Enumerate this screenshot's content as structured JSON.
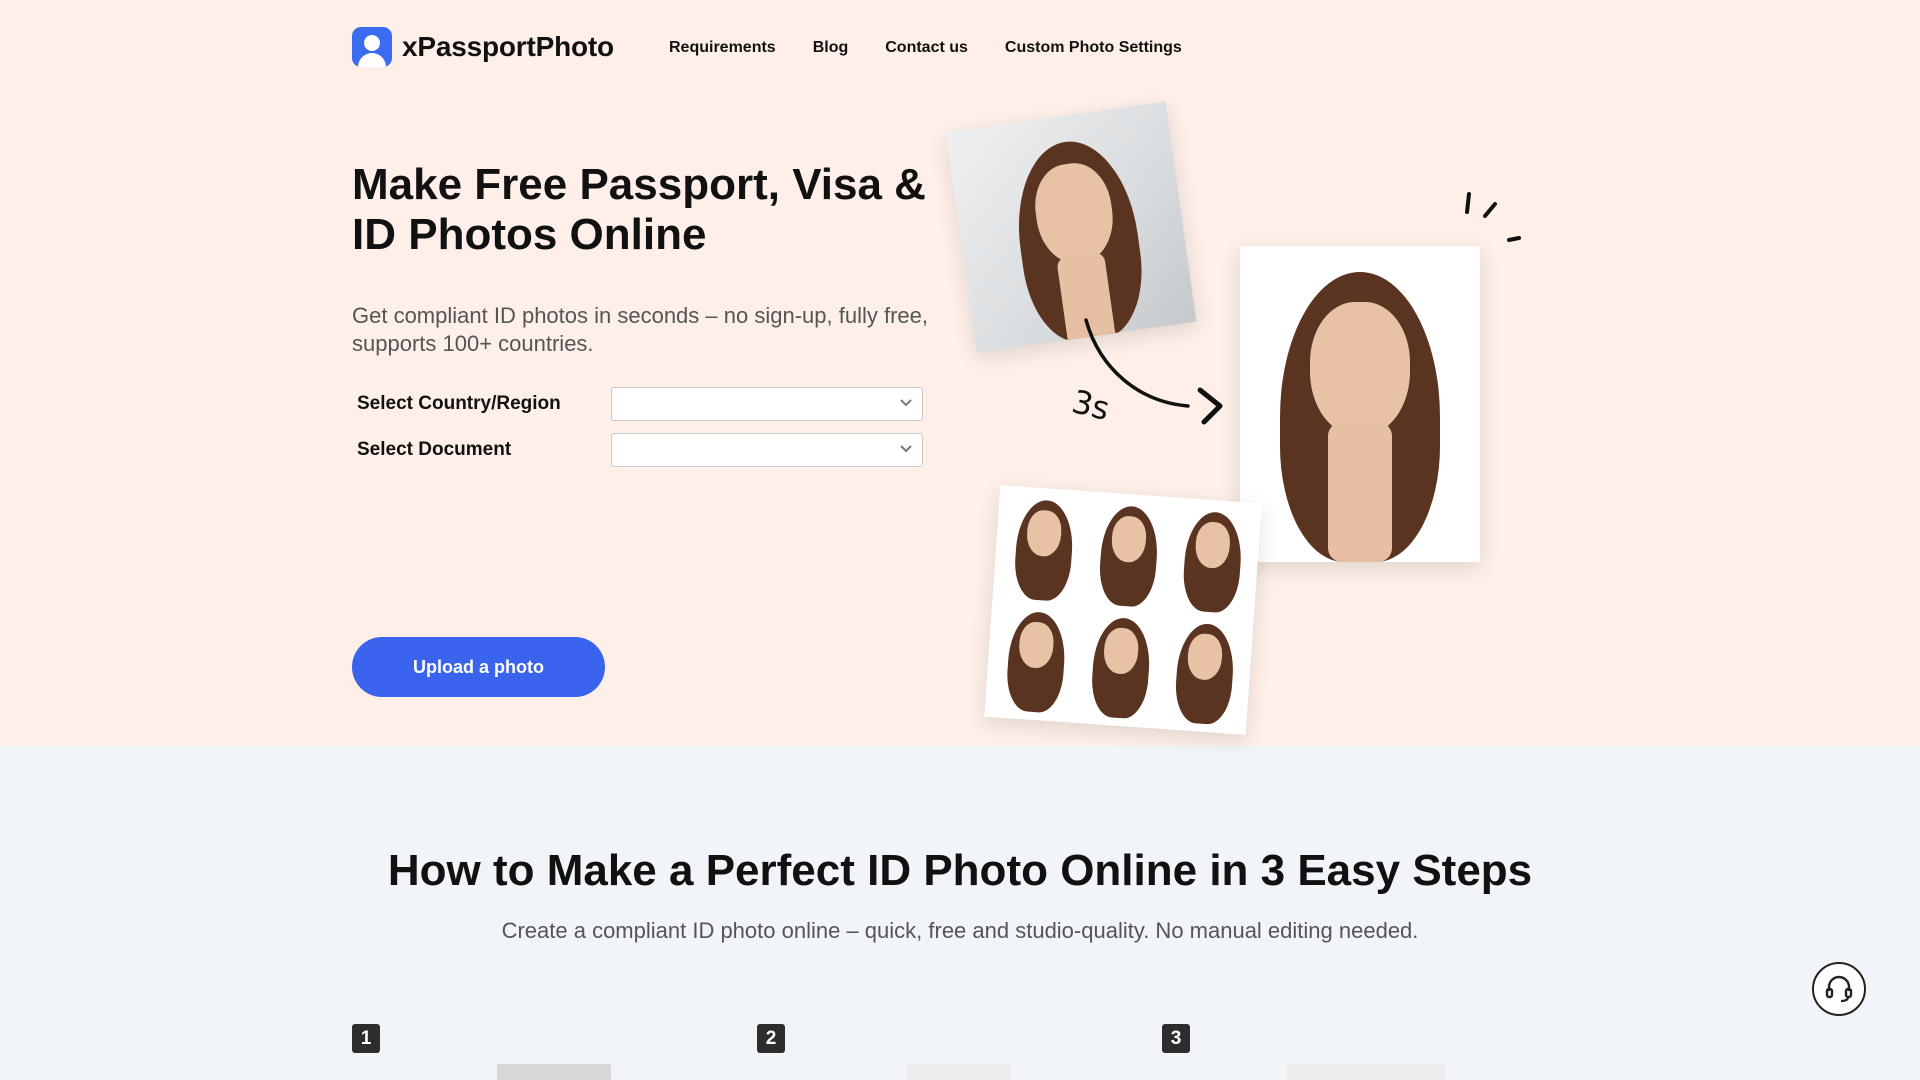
{
  "header": {
    "brand": "xPassportPhoto",
    "nav": [
      "Requirements",
      "Blog",
      "Contact us",
      "Custom Photo Settings"
    ]
  },
  "hero": {
    "title": "Make Free Passport, Visa & ID Photos Online",
    "subtitle": "Get compliant ID photos in seconds – no sign-up, fully free, supports 100+ countries.",
    "country_label": "Select Country/Region",
    "country_value": "",
    "document_label": "Select Document",
    "document_value": "",
    "upload_label": "Upload a photo",
    "timer_label": "3s"
  },
  "steps": {
    "title": "How to Make a Perfect ID Photo Online in 3 Easy Steps",
    "subtitle": "Create a compliant ID photo online – quick, free and studio-quality. No manual editing needed.",
    "numbers": [
      "1",
      "2",
      "3"
    ]
  },
  "colors": {
    "hero_bg": "#fef0e8",
    "section_bg": "#f1f4f9",
    "accent": "#3a63ee"
  },
  "icons": [
    "user-logo-icon",
    "chevron-down-icon",
    "headset-icon",
    "curved-arrow-icon",
    "sparkle-icon"
  ]
}
